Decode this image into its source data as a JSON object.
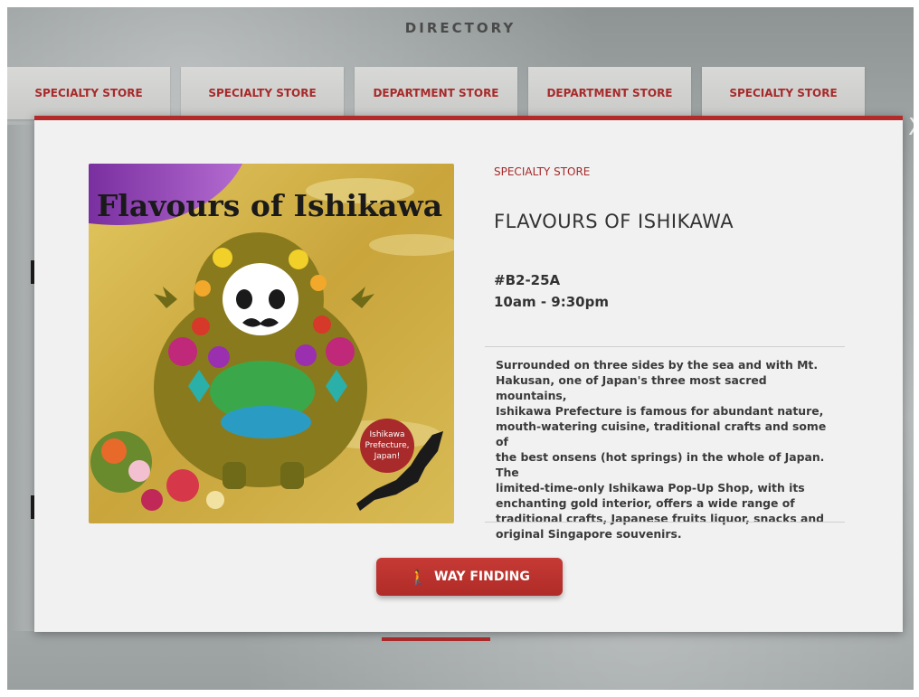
{
  "header": {
    "title": "DIRECTORY"
  },
  "tabs": [
    {
      "label": "SPECIALTY STORE"
    },
    {
      "label": "SPECIALTY STORE"
    },
    {
      "label": "DEPARTMENT STORE"
    },
    {
      "label": "DEPARTMENT STORE"
    },
    {
      "label": "SPECIALTY STORE"
    }
  ],
  "store": {
    "category": "SPECIALTY STORE",
    "name": "FLAVOURS OF ISHIKAWA",
    "unit": "#B2-25A",
    "hours": "10am - 9:30pm",
    "description": "Surrounded on three sides by the sea and with Mt.\nHakusan, one of Japan's three most sacred mountains,\nIshikawa Prefecture is famous for abundant nature,\nmouth-watering cuisine, traditional crafts and some of\nthe best onsens (hot springs) in the whole of Japan.  The\nlimited-time-only Ishikawa Pop-Up Shop, with its\nenchanting gold interior, offers a wide range of\ntraditional crafts, Japanese fruits liquor, snacks and\noriginal Singapore souvenirs."
  },
  "poster": {
    "title": "Flavours of Ishikawa",
    "badge_line1": "Ishikawa",
    "badge_line2": "Prefecture,",
    "badge_line3": "Japan!"
  },
  "actions": {
    "way_finding": "WAY FINDING",
    "walk_icon": "walking-person-icon"
  },
  "close": {
    "glyph": "X"
  },
  "colors": {
    "accent": "#b32a2a",
    "gold": "#c9a53c"
  }
}
